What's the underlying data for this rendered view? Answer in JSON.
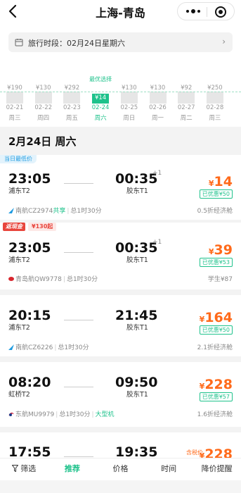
{
  "header": {
    "title": "上海-青岛"
  },
  "period": {
    "label": "旅行时段：",
    "value": "02月24日星期六"
  },
  "strip": {
    "best_label": "最优选择",
    "days": [
      {
        "price": "¥190",
        "date": "02-21",
        "week": "周三",
        "level": 0.55,
        "selected": false
      },
      {
        "price": "¥130",
        "date": "02-22",
        "week": "周四",
        "level": 0.55,
        "selected": false
      },
      {
        "price": "¥292",
        "date": "02-23",
        "week": "周五",
        "level": 0.55,
        "selected": false
      },
      {
        "price": "¥14",
        "date": "02-24",
        "week": "周六",
        "level": 0.45,
        "selected": true
      },
      {
        "price": "¥130",
        "date": "02-25",
        "week": "周日",
        "level": 0.55,
        "selected": false
      },
      {
        "price": "¥130",
        "date": "02-26",
        "week": "周一",
        "level": 0.55,
        "selected": false
      },
      {
        "price": "¥92",
        "date": "02-27",
        "week": "周二",
        "level": 0.55,
        "selected": false
      },
      {
        "price": "¥250",
        "date": "02-28",
        "week": "周三",
        "level": 0.55,
        "selected": false
      }
    ]
  },
  "list_date": "2月24日 周六",
  "flights": [
    {
      "tag": "当日最低价",
      "dep": "23:05",
      "arr": "00:35",
      "plus": "+1",
      "dep_port": "浦东T2",
      "arr_port": "胶东T1",
      "yen": "¥",
      "price": "14",
      "disc": "已优惠¥50",
      "airline": "南航CZ2974",
      "share": "共享",
      "duration": "总1时30分",
      "cabin": "0.5折经济舱"
    },
    {
      "ret_tag": "返现金",
      "cash_tag": "¥130起",
      "dep": "23:05",
      "arr": "00:35",
      "plus": "+1",
      "dep_port": "浦东T2",
      "arr_port": "胶东T1",
      "yen": "¥",
      "price": "39",
      "disc": "已优惠¥53",
      "airline": "青岛航QW9778",
      "duration": "总1时30分",
      "cabin": "学生¥87"
    },
    {
      "dep": "20:15",
      "arr": "21:45",
      "dep_port": "浦东T2",
      "arr_port": "胶东T1",
      "yen": "¥",
      "price": "164",
      "disc": "已优惠¥50",
      "airline": "南航CZ6226",
      "duration": "总1时30分",
      "cabin": "2.1折经济舱"
    },
    {
      "dep": "08:20",
      "arr": "09:50",
      "dep_port": "虹桥T2",
      "arr_port": "胶东T1",
      "yen": "¥",
      "price": "228",
      "disc": "已优惠¥57",
      "airline": "东航MU9979",
      "duration": "总1时30分",
      "big": "大型机",
      "cabin": "1.6折经济舱"
    },
    {
      "dep": "17:55",
      "arr": "19:35",
      "yen": "¥",
      "price": "228",
      "old_price": "含税价"
    }
  ],
  "bottom": {
    "filter": "筛选",
    "recommend": "推荐",
    "price": "价格",
    "time": "时间",
    "alert": "降价提醒"
  },
  "colors": {
    "accent": "#1ec28b",
    "price": "#ff6a1a",
    "red": "#e8453c"
  }
}
